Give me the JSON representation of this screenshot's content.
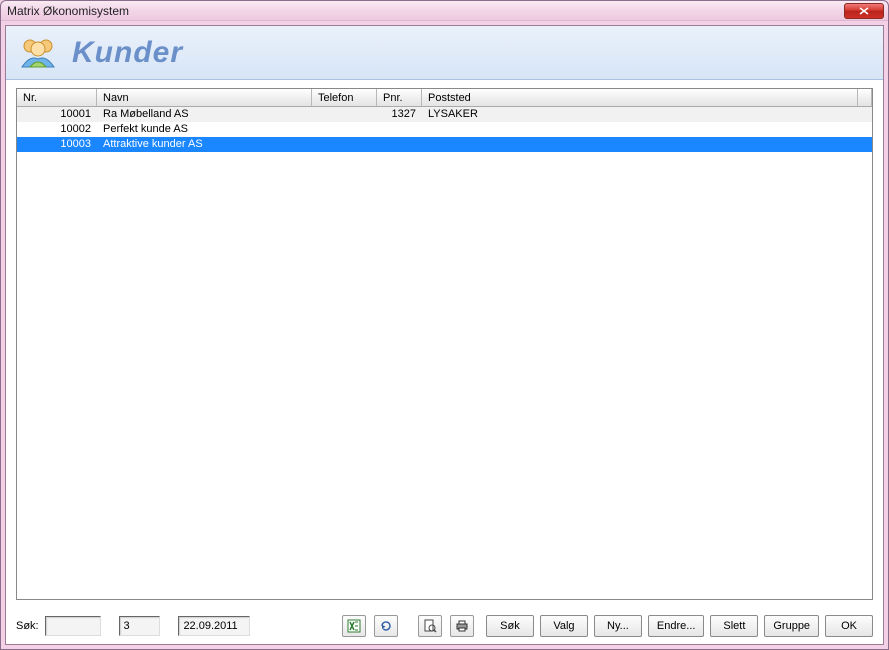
{
  "window": {
    "title": "Matrix Økonomisystem"
  },
  "header": {
    "title": "Kunder"
  },
  "grid": {
    "columns": {
      "nr": "Nr.",
      "navn": "Navn",
      "telefon": "Telefon",
      "pnr": "Pnr.",
      "poststed": "Poststed"
    },
    "rows": [
      {
        "nr": "10001",
        "navn": "Ra Møbelland AS",
        "telefon": "",
        "pnr": "1327",
        "poststed": "LYSAKER",
        "selected": false,
        "alt": true
      },
      {
        "nr": "10002",
        "navn": "Perfekt kunde AS",
        "telefon": "",
        "pnr": "",
        "poststed": "",
        "selected": false,
        "alt": false
      },
      {
        "nr": "10003",
        "navn": "Attraktive kunder AS",
        "telefon": "",
        "pnr": "",
        "poststed": "",
        "selected": true,
        "alt": false
      }
    ]
  },
  "footer": {
    "search_label": "Søk:",
    "search_value": "",
    "count": "3",
    "date": "22.09.2011",
    "buttons": {
      "sok": "Søk",
      "valg": "Valg",
      "ny": "Ny...",
      "endre": "Endre...",
      "slett": "Slett",
      "gruppe": "Gruppe",
      "ok": "OK"
    }
  }
}
